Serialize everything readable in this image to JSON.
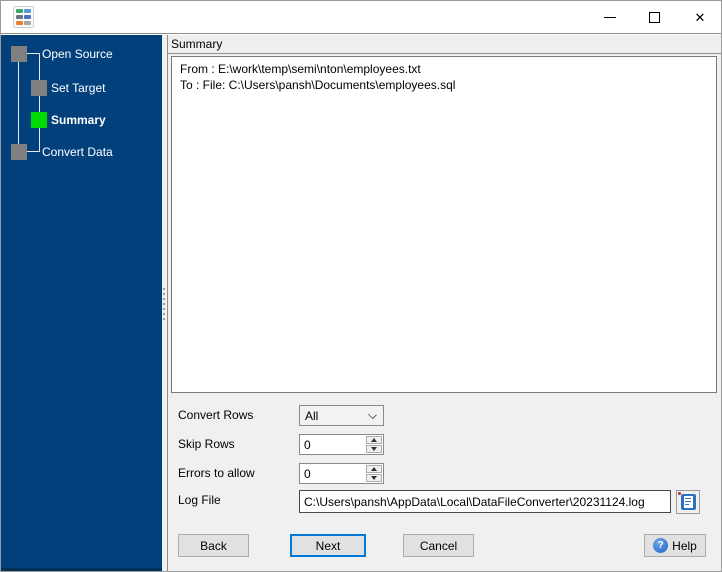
{
  "window": {
    "title": "",
    "icons": {
      "app": "data-file-converter-icon",
      "minimize": "minimize",
      "maximize": "maximize",
      "close": "✕"
    }
  },
  "colors": {
    "sidebar_bg": "#02407C",
    "sidebar_footer": "#013057",
    "active_step": "#00DC00",
    "inactive_step": "#808080",
    "accent_blue": "#0078D7"
  },
  "sidebar": {
    "steps": [
      {
        "label": "Open Source",
        "state": "done"
      },
      {
        "label": "Set Target",
        "state": "done"
      },
      {
        "label": "Summary",
        "state": "active"
      },
      {
        "label": "Convert Data",
        "state": "pending"
      }
    ]
  },
  "content": {
    "caption": "Summary",
    "summary_lines": [
      "From : E:\\work\\temp\\semi\\nton\\employees.txt",
      "To : File: C:\\Users\\pansh\\Documents\\employees.sql"
    ],
    "fields": {
      "convert_rows": {
        "label": "Convert Rows",
        "value": "All"
      },
      "skip_rows": {
        "label": "Skip Rows",
        "value": "0"
      },
      "errors_to_allow": {
        "label": "Errors to allow",
        "value": "0"
      },
      "log_file": {
        "label": "Log File",
        "value": "C:\\Users\\pansh\\AppData\\Local\\DataFileConverter\\20231124.log"
      }
    },
    "buttons": {
      "back": "Back",
      "next": "Next",
      "cancel": "Cancel",
      "help": "Help"
    }
  }
}
